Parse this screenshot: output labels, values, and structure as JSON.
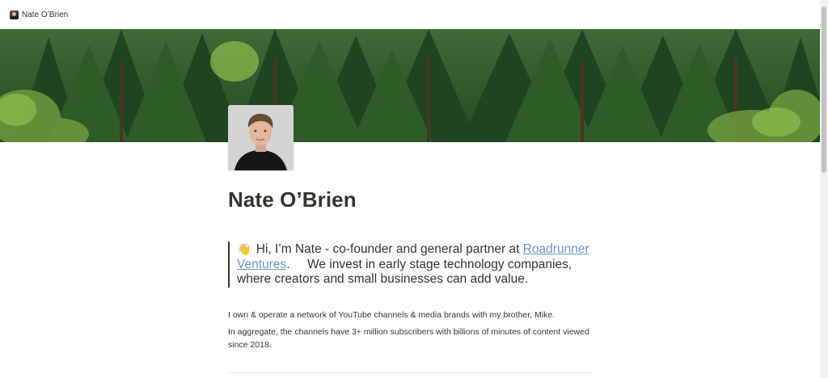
{
  "topbar": {
    "title": "Nate O’Brien",
    "avatar_icon": "profile-photo-icon"
  },
  "cover": {
    "description_color": "#2f5a2c"
  },
  "page": {
    "title": "Nate O’Brien",
    "quote": {
      "emoji": "👋",
      "text_before_link": "Hi, I’m Nate - co-founder and general partner at ",
      "link_text": "Roadrunner Ventures",
      "text_after_link": ".     We invest in early stage technology companies, where creators and small businesses can add value."
    },
    "paragraph_1": "I own & operate a network of YouTube channels & media brands with my brother, Mike.",
    "paragraph_2": "In aggregate, the channels have 3+ million subscribers with billions of minutes of content viewed since 2018."
  },
  "colors": {
    "link": "#6d96c4",
    "text": "#37352f"
  }
}
